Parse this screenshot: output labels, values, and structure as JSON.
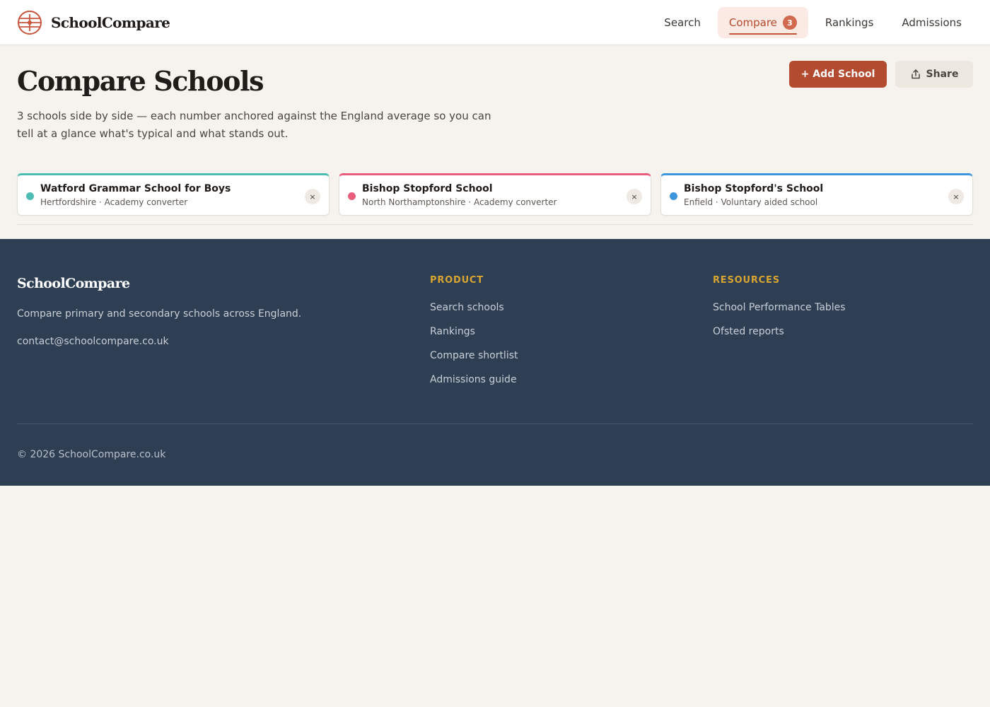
{
  "header": {
    "brand": "SchoolCompare",
    "nav": [
      {
        "label": "Search"
      },
      {
        "label": "Compare",
        "badge": "3",
        "active": true
      },
      {
        "label": "Rankings"
      },
      {
        "label": "Admissions"
      }
    ]
  },
  "hero": {
    "title": "Compare Schools",
    "subtitle": "3 schools side by side — each number anchored against the England average so you can tell at a glance what's typical and what stands out.",
    "add_button": "+ Add School",
    "share_button": "Share"
  },
  "schools": [
    {
      "name": "Watford Grammar School for Boys",
      "meta": "Hertfordshire · Academy converter",
      "color": "#4dbdb4",
      "remove_icon": "×"
    },
    {
      "name": "Bishop Stopford School",
      "meta": "North Northamptonshire · Academy converter",
      "color": "#ea5d7c",
      "remove_icon": "×"
    },
    {
      "name": "Bishop Stopford's School",
      "meta": "Enfield · Voluntary aided school",
      "color": "#3d96dd",
      "remove_icon": "×"
    }
  ],
  "footer": {
    "brand": "SchoolCompare",
    "description": "Compare primary and secondary schools across England.",
    "email": "contact@schoolcompare.co.uk",
    "product": {
      "heading": "PRODUCT",
      "links": [
        "Search schools",
        "Rankings",
        "Compare shortlist",
        "Admissions guide"
      ]
    },
    "resources": {
      "heading": "RESOURCES",
      "links": [
        "School Performance Tables",
        "Ofsted reports"
      ]
    },
    "copyright": "© 2026 SchoolCompare.co.uk"
  },
  "colors": {
    "accent": "#b24b30",
    "footer_bg": "#2f3f53",
    "footer_heading": "#d8a531",
    "page_bg": "#f6f3ee"
  }
}
